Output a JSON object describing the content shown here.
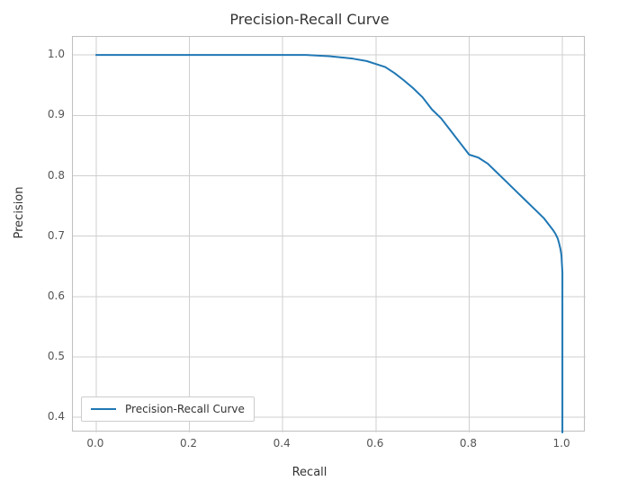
{
  "chart_data": {
    "type": "line",
    "title": "Precision-Recall Curve",
    "xlabel": "Recall",
    "ylabel": "Precision",
    "xlim": [
      -0.05,
      1.05
    ],
    "ylim": [
      0.375,
      1.03
    ],
    "xticks": [
      0.0,
      0.2,
      0.4,
      0.6,
      0.8,
      1.0
    ],
    "yticks": [
      0.4,
      0.5,
      0.6,
      0.7,
      0.8,
      0.9,
      1.0
    ],
    "legend_position": "lower left",
    "grid": true,
    "series": [
      {
        "name": "Precision-Recall Curve",
        "x": [
          0.0,
          0.05,
          0.1,
          0.15,
          0.2,
          0.25,
          0.3,
          0.35,
          0.4,
          0.45,
          0.5,
          0.55,
          0.58,
          0.6,
          0.62,
          0.64,
          0.66,
          0.68,
          0.7,
          0.72,
          0.74,
          0.76,
          0.78,
          0.8,
          0.82,
          0.84,
          0.86,
          0.88,
          0.9,
          0.92,
          0.94,
          0.96,
          0.97,
          0.98,
          0.985,
          0.99,
          0.993,
          0.996,
          0.998,
          1.0,
          1.0,
          1.0,
          1.0
        ],
        "y": [
          1.0,
          1.0,
          1.0,
          1.0,
          1.0,
          1.0,
          1.0,
          1.0,
          1.0,
          1.0,
          0.998,
          0.994,
          0.99,
          0.985,
          0.98,
          0.97,
          0.958,
          0.945,
          0.93,
          0.91,
          0.895,
          0.875,
          0.855,
          0.835,
          0.83,
          0.82,
          0.805,
          0.79,
          0.775,
          0.76,
          0.745,
          0.73,
          0.72,
          0.71,
          0.704,
          0.696,
          0.688,
          0.678,
          0.668,
          0.64,
          0.56,
          0.47,
          0.375
        ]
      }
    ]
  }
}
